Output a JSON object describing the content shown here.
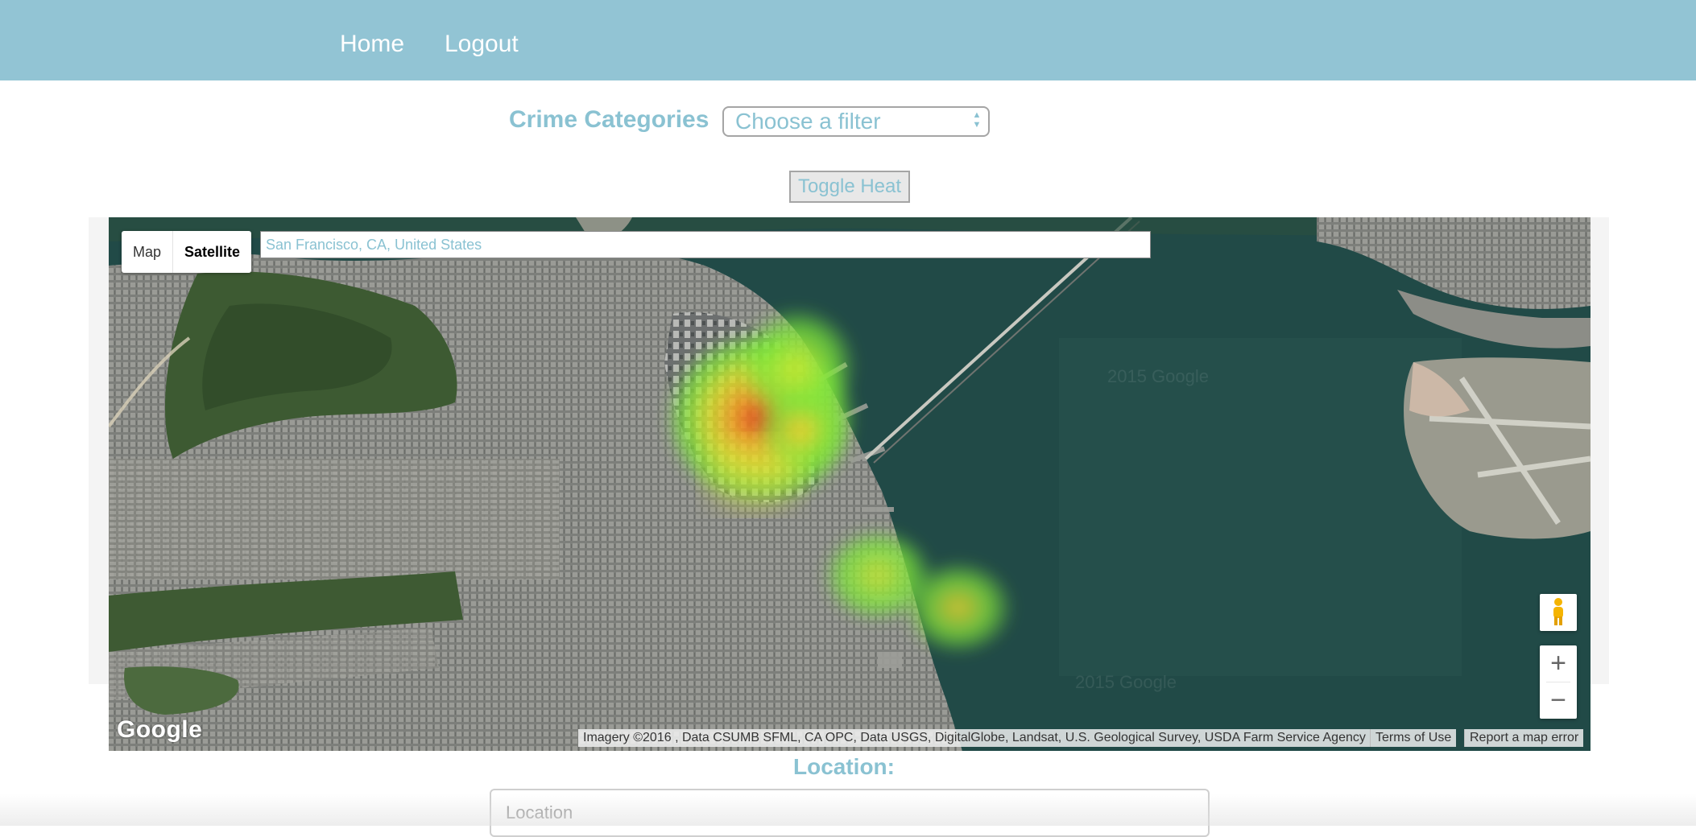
{
  "nav": {
    "home_label": "Home",
    "logout_label": "Logout",
    "background": "#92c4d4"
  },
  "filter": {
    "label": "Crime Categories",
    "selected_value": "Choose a filter"
  },
  "toggle_heat_label": "Toggle Heat",
  "map": {
    "type_map_label": "Map",
    "type_satellite_label": "Satellite",
    "selected_type": "Satellite",
    "search_value": "San Francisco, CA, United States",
    "zoom_in_label": "+",
    "zoom_out_label": "−",
    "logo_text": "Google",
    "attribution": "Imagery ©2016 , Data CSUMB SFML, CA OPC, Data USGS, DigitalGlobe, Landsat, U.S. Geological Survey, USDA Farm Service Agency",
    "terms_label": "Terms of Use",
    "report_label": "Report a map error",
    "watermark_1": "2015 Google",
    "watermark_2": "2015 Google",
    "heat_colors": [
      "#e23a20",
      "#f6d22a",
      "#7be83a"
    ]
  },
  "location": {
    "label": "Location:",
    "placeholder": "Location"
  },
  "colors": {
    "accent_text": "#8ac2d2",
    "water": "#1f4744"
  }
}
